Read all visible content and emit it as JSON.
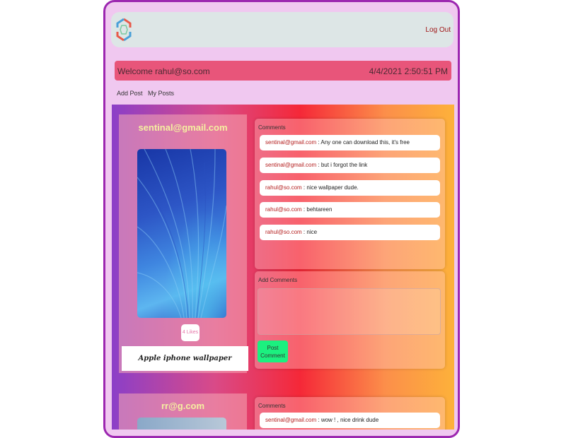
{
  "header": {
    "logout_label": "Log Out"
  },
  "welcome": {
    "greeting": "Welcome rahul@so.com",
    "datetime": "4/4/2021 2:50:51 PM"
  },
  "nav": {
    "add_post": "Add Post",
    "my_posts": "My Posts"
  },
  "posts": [
    {
      "user": "sentinal@gmail.com",
      "likes_label": "4 Likes",
      "caption": "Apple iphone wallpaper",
      "comments_label": "Comments",
      "comments": [
        {
          "author": "sentinal@gmail.com",
          "text": " : Any one can download this, it's free"
        },
        {
          "author": "sentinal@gmail.com",
          "text": " : but i forgot the link"
        },
        {
          "author": "rahul@so.com",
          "text": " : nice wallpaper dude."
        },
        {
          "author": "rahul@so.com",
          "text": " : behtareen"
        },
        {
          "author": "rahul@so.com",
          "text": " : nice"
        }
      ],
      "add_comments_label": "Add Comments",
      "post_button_line1": "Post",
      "post_button_line2": "Comment"
    },
    {
      "user": "rr@g.com",
      "comments_label": "Comments",
      "comments": [
        {
          "author": "sentinal@gmail.com",
          "text": " : wow ! , nice drink dude"
        }
      ]
    }
  ]
}
